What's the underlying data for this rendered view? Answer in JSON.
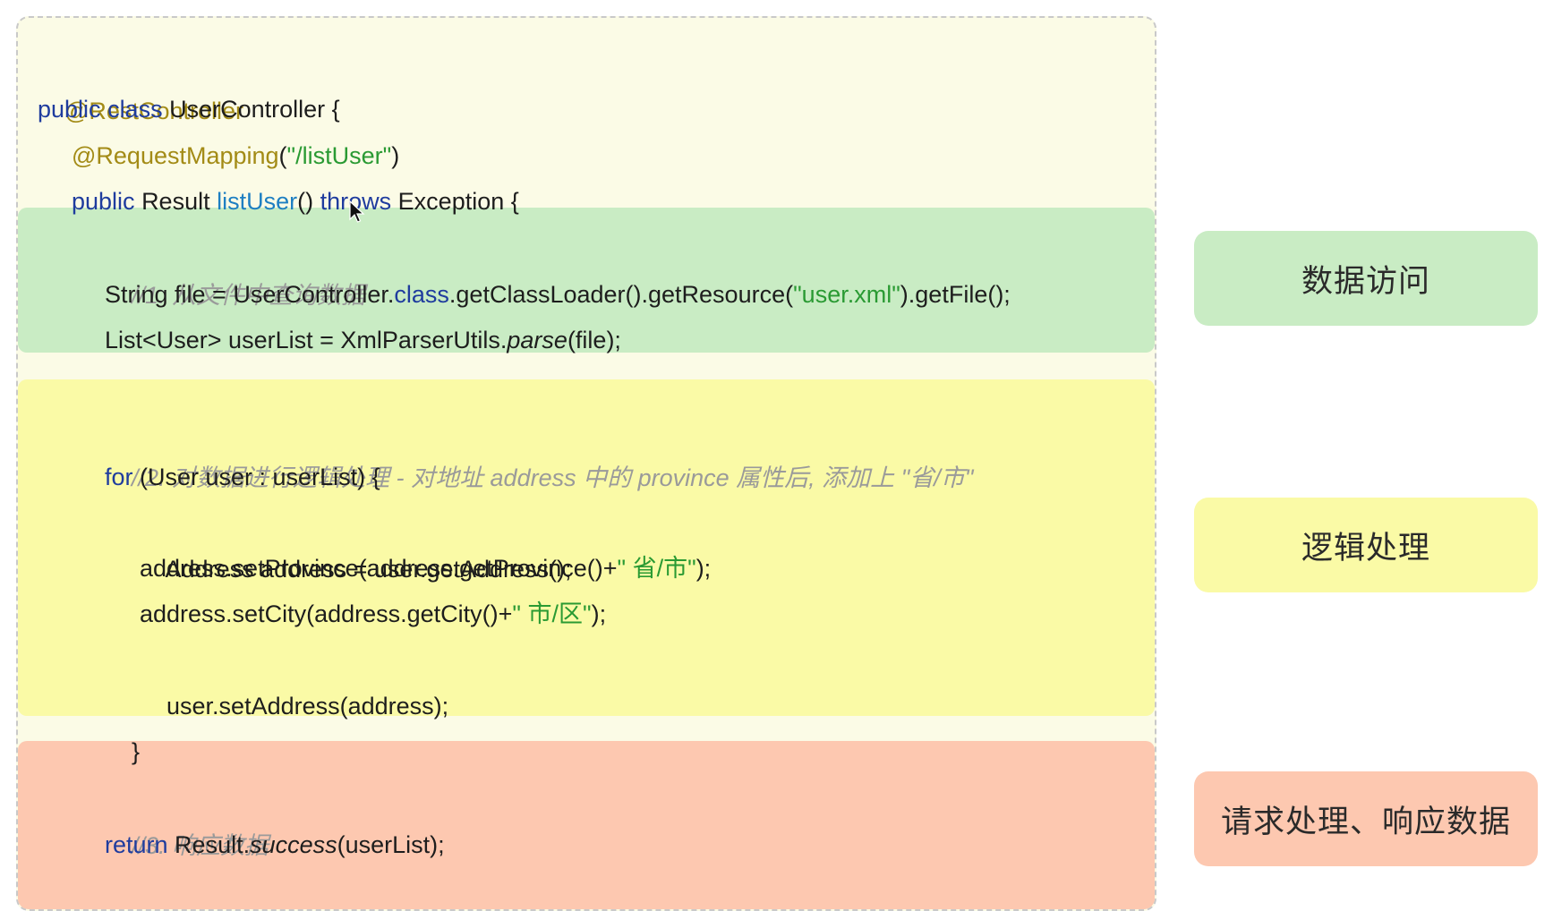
{
  "code": {
    "annotation_rest": "@RestController",
    "class_line": {
      "kw1": "public",
      "kw2": "class",
      "name": "UserController {"
    },
    "mapping": {
      "annotation": "@RequestMapping",
      "open": "(",
      "path": "\"/listUser\"",
      "close": ")"
    },
    "method_line": {
      "kw1": "public",
      "type": "Result",
      "name": "listUser",
      "parens": "()",
      "kw2": "throws",
      "rest": "Exception {"
    },
    "section1": {
      "comment": "//1. 从文件中查询数据",
      "line1": {
        "prefix": "String file = UserController.",
        "kw": "class",
        "middle": ".getClassLoader().getResource(",
        "str": "\"user.xml\"",
        "suffix": ").getFile();"
      },
      "line2": {
        "prefix": "List<User> userList = XmlParserUtils.",
        "italic": "parse",
        "suffix": "(file);"
      }
    },
    "section2": {
      "comment": "//2. 对数据进行逻辑处理 - 对地址 address 中的 province 属性后, 添加上 \"省/市\"",
      "for_line": {
        "kw": "for",
        "rest": " (User user : userList) {"
      },
      "line_address": "Address address = user.getAddress();",
      "line_province": {
        "prefix": "address.setProvince(address.getProvince()+",
        "str": "\" 省/市\"",
        "suffix": ");"
      },
      "line_city": {
        "prefix": "address.setCity(address.getCity()+",
        "str": "\" 市/区\"",
        "suffix": ");"
      },
      "line_set": "user.setAddress(address);",
      "close_brace": "}"
    },
    "section3": {
      "comment": "//3. 响应数据",
      "return_line": {
        "kw": "return",
        "prefix": " Result.",
        "italic": "success",
        "suffix": "(userList);"
      },
      "close_brace": "}"
    }
  },
  "labels": {
    "data_access": "数据访问",
    "logic": "逻辑处理",
    "request_response": "请求处理、响应数据"
  },
  "colors": {
    "green_band": "#c9ecc4",
    "yellow_band": "#fafaa6",
    "salmon_band": "#fdc8b0",
    "annotation": "#a38b16",
    "keyword": "#1f3c9e",
    "method": "#1e7fc2",
    "string": "#2a9a33",
    "comment": "#9a9a9a"
  },
  "icons": {
    "cursor": "mouse-pointer-icon"
  }
}
